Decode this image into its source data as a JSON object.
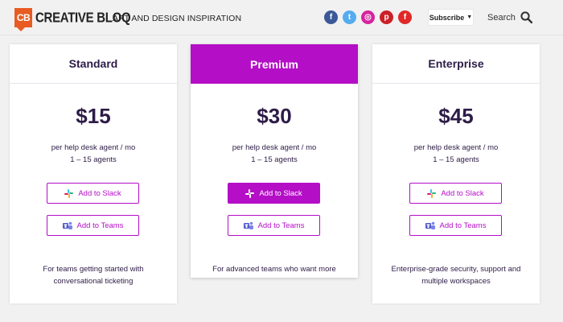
{
  "header": {
    "logo_mark": "CB",
    "logo_word": "CREATIVE BLOQ",
    "tagline": "ART AND DESIGN INSPIRATION",
    "social": [
      {
        "icon": "facebook-icon",
        "glyph": "f",
        "color": "#3b5998"
      },
      {
        "icon": "twitter-icon",
        "glyph": "t",
        "color": "#55acee"
      },
      {
        "icon": "instagram-icon",
        "glyph": "◎",
        "color": "#d6249f"
      },
      {
        "icon": "pinterest-icon",
        "glyph": "p",
        "color": "#cb2027"
      },
      {
        "icon": "flipboard-icon",
        "glyph": "f",
        "color": "#e12828"
      }
    ],
    "subscribe_label": "Subscribe",
    "search_label": "Search"
  },
  "plans": [
    {
      "name": "Standard",
      "price": "$15",
      "unit": "per help desk agent / mo",
      "range": "1 – 15 agents",
      "slack_label": "Add to Slack",
      "teams_label": "Add to Teams",
      "footer": "For teams getting started with conversational ticketing"
    },
    {
      "name": "Premium",
      "price": "$30",
      "unit": "per help desk agent / mo",
      "range": "1 – 15 agents",
      "slack_label": "Add to Slack",
      "teams_label": "Add to Teams",
      "footer": "For advanced teams who want more"
    },
    {
      "name": "Enterprise",
      "price": "$45",
      "unit": "per help desk agent / mo",
      "range": "1 – 15 agents",
      "slack_label": "Add to Slack",
      "teams_label": "Add to Teams",
      "footer": "Enterprise-grade security, support and multiple workspaces"
    }
  ],
  "colors": {
    "accent": "#b40ec6",
    "text": "#2d1c47",
    "logo": "#e85b22"
  }
}
